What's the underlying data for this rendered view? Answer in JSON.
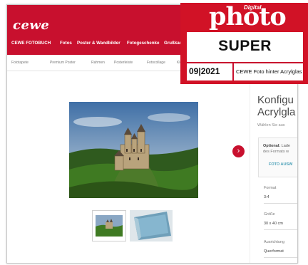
{
  "site": {
    "logo": "cewe",
    "main_nav": [
      "CEWE FOTOBUCH",
      "Fotos",
      "Poster & Wandbilder",
      "Fotogeschenke",
      "Grußkarten"
    ],
    "sub_nav": [
      "Fototapete",
      "Premium Poster",
      "Rahmen",
      "Posterleiste",
      "Fotocollage",
      "Kle"
    ]
  },
  "product": {
    "title_line1": "Konfigu",
    "title_line2": "Acrylgla",
    "subtitle": "Wählen Sie aus",
    "option_box": {
      "label_bold": "Optional:",
      "label_rest": " Lade",
      "text": "des Formats w",
      "link": "FOTO AUSW"
    },
    "fields": [
      {
        "label": "Format",
        "value": "3:4"
      },
      {
        "label": "Größe",
        "value": "30 x 40 cm"
      },
      {
        "label": "Ausrichtung",
        "value": "Querformat"
      }
    ],
    "next_arrow": "›"
  },
  "badge": {
    "brand_small": "Digital",
    "brand": "photo",
    "rating": "SUPER",
    "issue": "09|2021",
    "product": "CEWE Foto hinter Acrylglas"
  },
  "colors": {
    "brand_red": "#c8102e",
    "badge_red": "#d11226",
    "link_teal": "#4aa0b8"
  }
}
